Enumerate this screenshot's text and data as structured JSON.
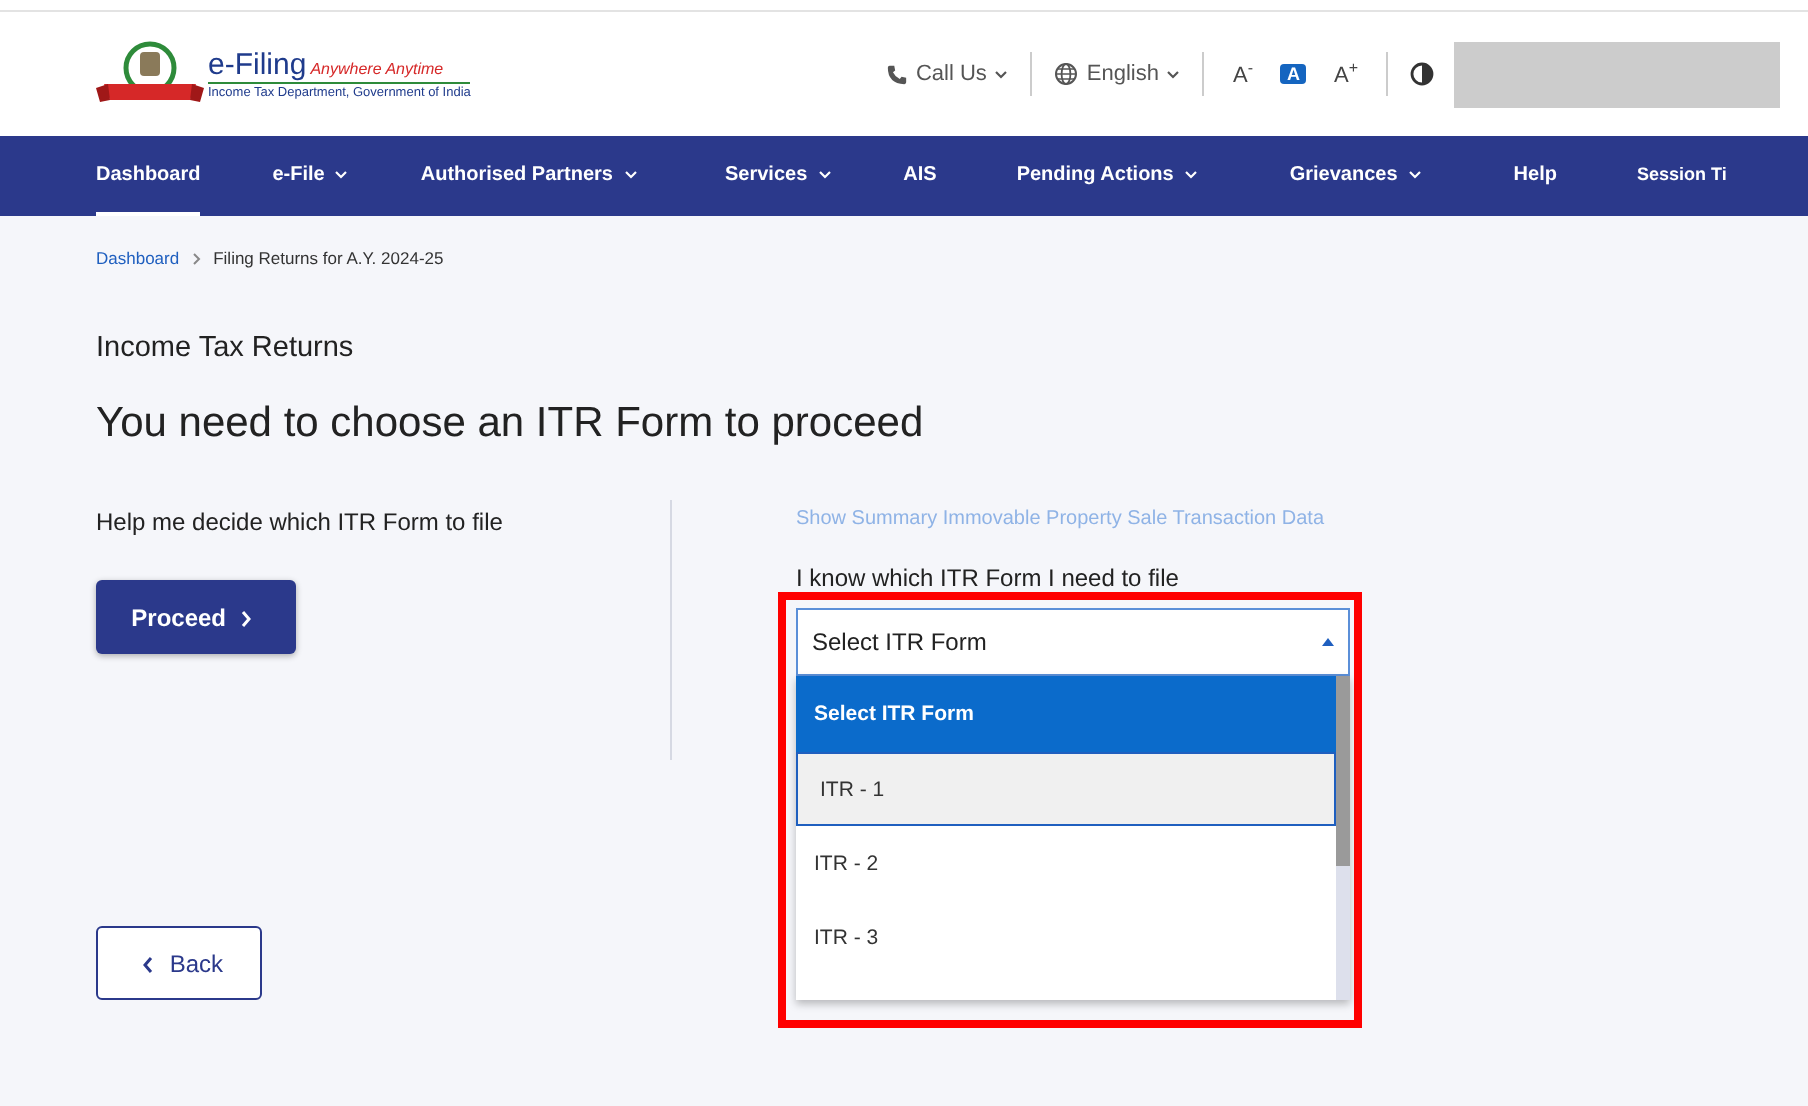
{
  "header": {
    "logo_title": "e-Filing",
    "logo_tagline": "Anywhere Anytime",
    "logo_subtitle": "Income Tax Department, Government of India",
    "call_us": "Call Us",
    "language": "English",
    "font_decrease": "A$^{-}$",
    "font_reset": "A",
    "font_increase": "A$^{+}$"
  },
  "nav": [
    {
      "label": "Dashboard",
      "selected": true,
      "dropdown": false
    },
    {
      "label": "e-File",
      "selected": false,
      "dropdown": true
    },
    {
      "label": "Authorised Partners",
      "selected": false,
      "dropdown": true
    },
    {
      "label": "Services",
      "selected": false,
      "dropdown": true
    },
    {
      "label": "AIS",
      "selected": false,
      "dropdown": false
    },
    {
      "label": "Pending Actions",
      "selected": false,
      "dropdown": true
    },
    {
      "label": "Grievances",
      "selected": false,
      "dropdown": true
    },
    {
      "label": "Help",
      "selected": false,
      "dropdown": false
    },
    {
      "label": "Session Ti",
      "selected": false,
      "dropdown": false
    }
  ],
  "breadcrumb": [
    {
      "label": "Dashboard",
      "kind": "link"
    },
    {
      "label": "Filing Returns for A.Y. 2024-25",
      "kind": "current"
    }
  ],
  "section_title": "Income Tax Returns",
  "heading": "You need to choose an ITR Form to proceed",
  "left": {
    "text": "Help me decide which ITR Form to file",
    "button": "Proceed",
    "back_button": "Back"
  },
  "right": {
    "link": "Show Summary Immovable Property Sale Transaction Data",
    "label": "I know which ITR Form I need to file",
    "select": {
      "value": "Select ITR Form",
      "expanded": true,
      "options": [
        {
          "label": "Select ITR Form",
          "selected": true,
          "highlighted": false
        },
        {
          "label": "ITR - 1",
          "selected": false,
          "highlighted": true
        },
        {
          "label": "ITR - 2",
          "selected": false,
          "highlighted": false
        },
        {
          "label": "ITR - 3",
          "selected": false,
          "highlighted": false
        }
      ]
    }
  }
}
